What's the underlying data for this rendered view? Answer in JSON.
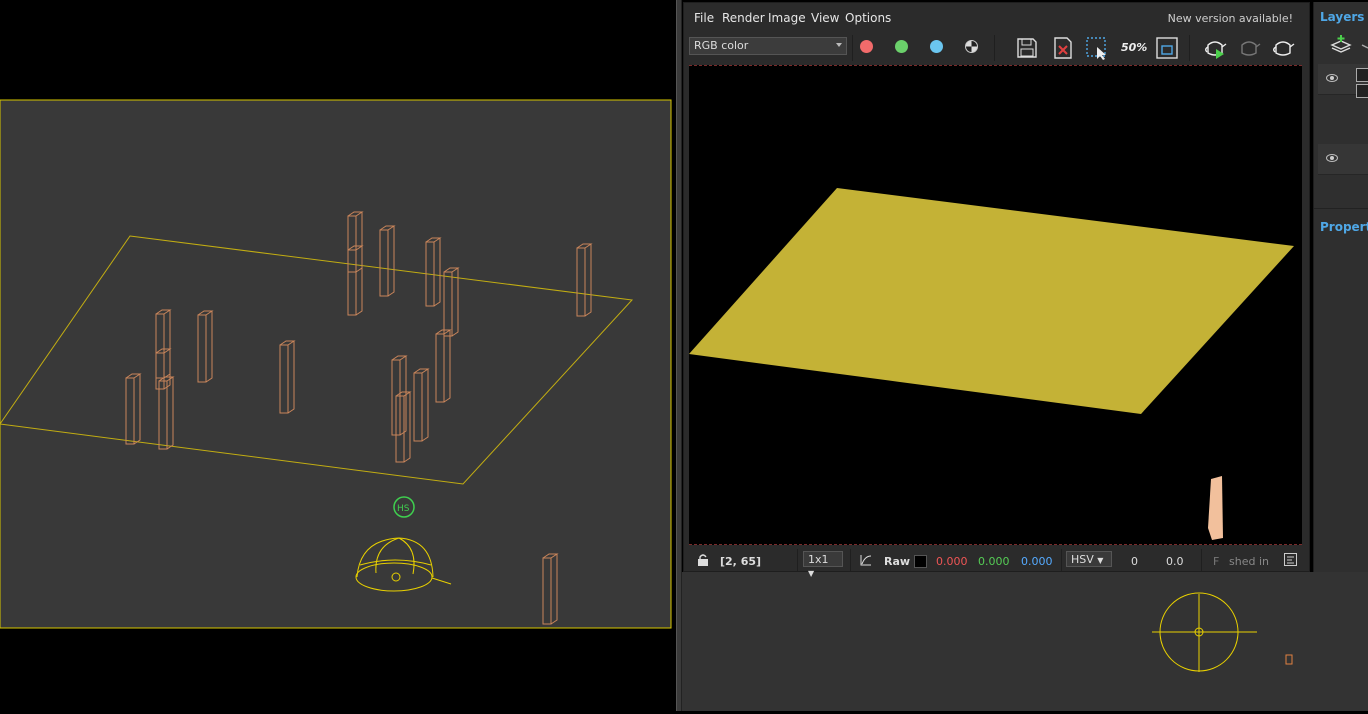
{
  "vfb": {
    "menu": [
      "File",
      "Render",
      "Image",
      "View",
      "Options"
    ],
    "new_version": "New version available!",
    "channel": "RGB color",
    "toolbar_icons": [
      "red-channel-icon",
      "green-channel-icon",
      "blue-channel-icon",
      "alpha-channel-icon",
      "save-image-icon",
      "clear-image-icon",
      "region-render-icon",
      "zoom-50-icon",
      "frame-icon",
      "render-teapot-icon",
      "stop-teapot-icon",
      "interactive-teapot-icon"
    ],
    "zoom_label": "50%",
    "status": {
      "coords": "[2, 65]",
      "ratio": "1x1",
      "raw": "Raw",
      "r": "0.000",
      "g": "0.000",
      "b": "0.000",
      "color_mode": "HSV",
      "h": "0",
      "s": "0.0",
      "finished": "shed in",
      "finished_prefix": "F"
    }
  },
  "layers": {
    "title": "Layers",
    "properties_title": "Properti"
  },
  "colors": {
    "accent": "#4fa7e6",
    "wire_yellow": "#e8d000",
    "wire_orange": "#c9855a",
    "plane_yellow": "#c4b236",
    "helper_green": "#3fcf4f"
  }
}
